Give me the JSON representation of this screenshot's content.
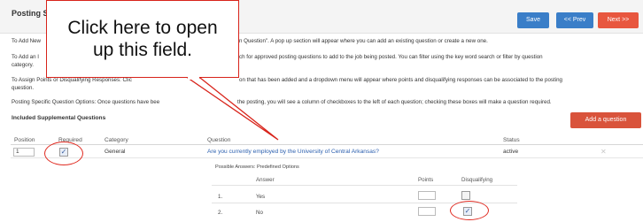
{
  "header": {
    "title": "Posting S",
    "buttons": {
      "save": "Save",
      "prev": "<< Prev",
      "next": "Next >>"
    }
  },
  "instructions": {
    "add_new": "To Add New",
    "add_new_tail": "n Question\". A pop up section will appear where you can add an existing question or create a new one.",
    "add_an": "To Add an I",
    "add_an_tail": "ch for approved posting questions to add to the job being posted. You can filter using the key word search or filter by question",
    "add_an_cont": "category.",
    "assign": "To Assign Points or Disqualifying Responses: Clic",
    "assign_tail": "on that has been added and a dropdown menu will appear where points and disqualifying responses can be associated to the posting",
    "assign_cont": "question.",
    "specific": "Posting Specific Question Options: Once questions have bee",
    "specific_tail": "the posting, you will see a column of checkboxes to the left of each question; checking these boxes will make a question required."
  },
  "section": {
    "title": "Included Supplemental Questions",
    "add_button": "Add a question"
  },
  "table": {
    "headers": {
      "position": "Position",
      "required": "Required",
      "category": "Category",
      "question": "Question",
      "status": "Status"
    },
    "rows": [
      {
        "position": "1",
        "required": true,
        "category": "General",
        "question": "Are you currently employed by the University of Central Arkansas?",
        "status": "active"
      }
    ]
  },
  "answers": {
    "title": "Possible Answers: Predefined Options",
    "headers": {
      "answer": "Answer",
      "points": "Points",
      "disqualifying": "Disqualifying"
    },
    "rows": [
      {
        "num": "1.",
        "answer": "Yes",
        "disqualifying": false
      },
      {
        "num": "2.",
        "answer": "No",
        "disqualifying": true
      }
    ]
  },
  "callout": {
    "line1": "Click here to open",
    "line2": "up this field."
  },
  "icons": {
    "remove": "close-icon",
    "check": "checkmark-icon"
  },
  "colors": {
    "primary_button": "#3a7ec8",
    "next_button": "#e8573f",
    "add_button": "#d9533b",
    "annotation": "#e02a20",
    "link": "#2a5eae"
  }
}
